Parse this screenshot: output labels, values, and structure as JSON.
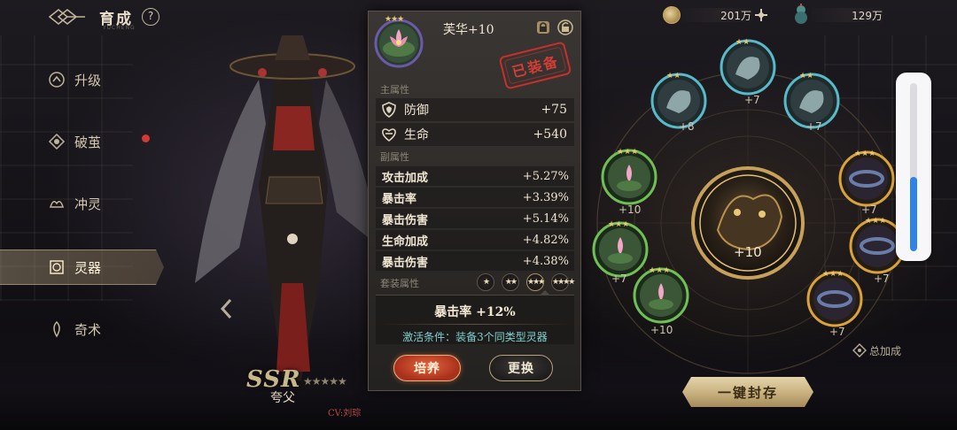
{
  "header": {
    "title": "育成",
    "help": "?",
    "subtitle": "YUCHENG"
  },
  "sidebar": {
    "items": [
      {
        "label": "升级",
        "icon": "level-up-icon"
      },
      {
        "label": "破茧",
        "icon": "cocoon-icon"
      },
      {
        "label": "冲灵",
        "icon": "spirit-icon"
      },
      {
        "label": "灵器",
        "icon": "artifact-icon",
        "active": true
      },
      {
        "label": "奇术",
        "icon": "magic-icon"
      }
    ]
  },
  "character": {
    "rarity": "SSR",
    "rarity_stars": "★★★★★",
    "name": "夸父",
    "cv": "CV:刘琮"
  },
  "currency": [
    {
      "icon": "coin-icon",
      "value": "201万"
    },
    {
      "icon": "gourd-icon",
      "value": "129万"
    }
  ],
  "detail": {
    "item_name": "芙华+10",
    "stars": "★★★",
    "equipped_stamp": "已装备",
    "main_label": "主属性",
    "main_stats": [
      {
        "icon": "shield-icon",
        "label": "防御",
        "value": "+75"
      },
      {
        "icon": "heart-icon",
        "label": "生命",
        "value": "+540"
      }
    ],
    "sub_label": "副属性",
    "sub_stats": [
      {
        "label": "攻击加成",
        "value": "+5.27%"
      },
      {
        "label": "暴击率",
        "value": "+3.39%"
      },
      {
        "label": "暴击伤害",
        "value": "+5.14%"
      },
      {
        "label": "生命加成",
        "value": "+4.82%"
      },
      {
        "label": "暴击伤害",
        "value": "+4.38%"
      }
    ],
    "set_label": "套装属性",
    "set_tiers": [
      "★",
      "★★",
      "★★★",
      "★★★★"
    ],
    "set_bonus": "暴击率 +12%",
    "set_condition": "激活条件：装备3个同类型灵器",
    "train_button": "培养",
    "swap_button": "更换"
  },
  "ring": {
    "center_level": "+10",
    "slots": [
      {
        "label": "+8",
        "frame": "teal"
      },
      {
        "label": "+7",
        "frame": "teal"
      },
      {
        "label": "+7",
        "frame": "teal"
      },
      {
        "label": "+10",
        "frame": "green"
      },
      {
        "label": "+7",
        "frame": "green"
      },
      {
        "label": "+10",
        "frame": "green"
      },
      {
        "label": "+7",
        "frame": "gold"
      },
      {
        "label": "+7",
        "frame": "gold"
      },
      {
        "label": "+7",
        "frame": "gold"
      }
    ]
  },
  "total_bonus": "总加成",
  "seal_button": "一键封存",
  "scroll": {
    "level": 0.44,
    "accent": "#2f83e6"
  }
}
